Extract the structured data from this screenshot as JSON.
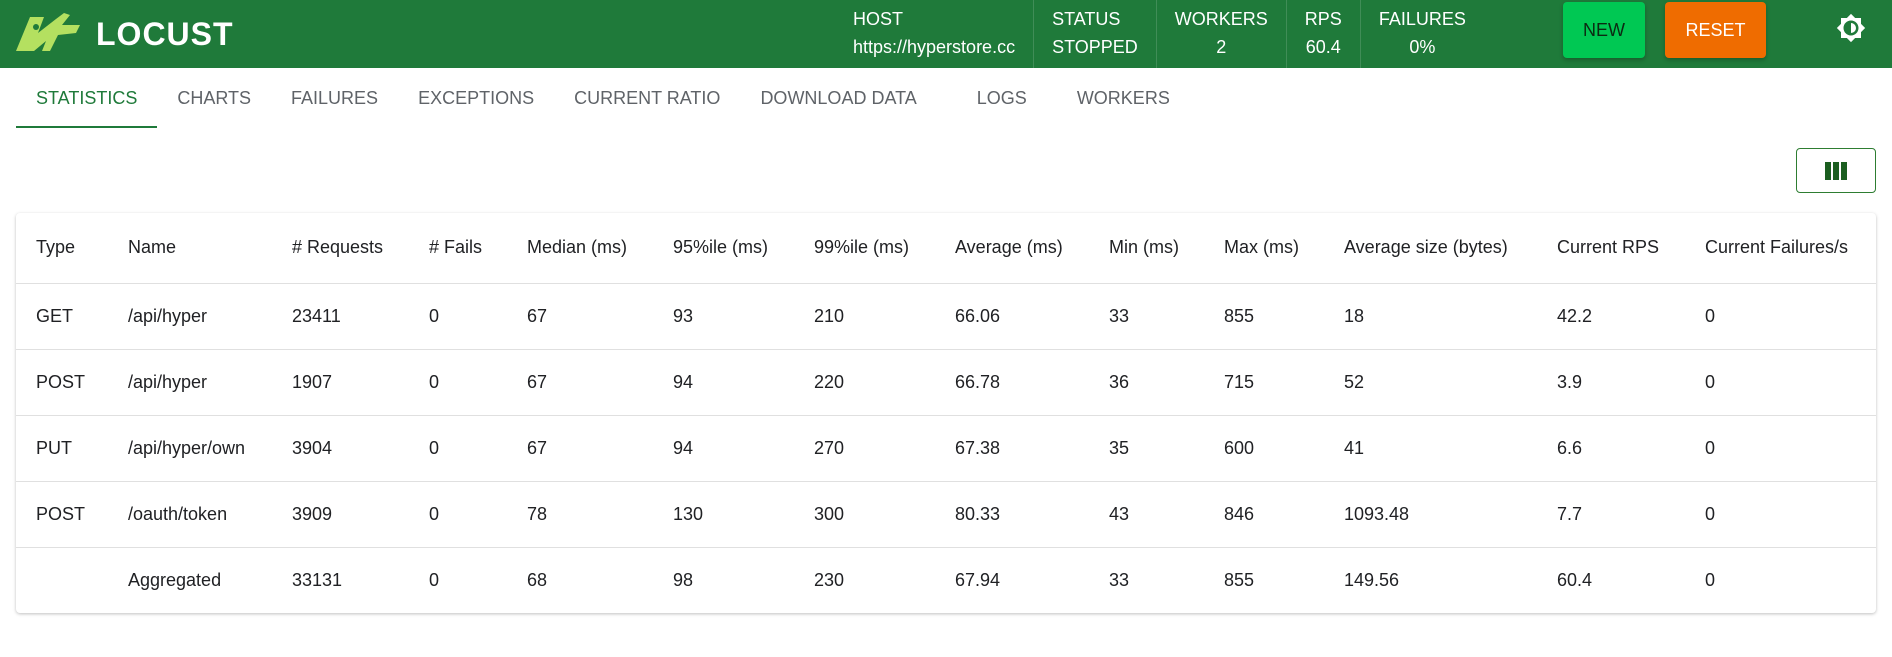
{
  "header": {
    "brand": "LOCUST",
    "stats": [
      {
        "label": "HOST",
        "value": "https://hyperstore.cc"
      },
      {
        "label": "STATUS",
        "value": "STOPPED"
      },
      {
        "label": "WORKERS",
        "value": "2"
      },
      {
        "label": "RPS",
        "value": "60.4"
      },
      {
        "label": "FAILURES",
        "value": "0%"
      }
    ],
    "new_label": "NEW",
    "reset_label": "RESET",
    "theme_icon": "brightness-icon"
  },
  "tabs": [
    {
      "label": "STATISTICS",
      "active": true
    },
    {
      "label": "CHARTS"
    },
    {
      "label": "FAILURES"
    },
    {
      "label": "EXCEPTIONS"
    },
    {
      "label": "CURRENT RATIO"
    },
    {
      "label": "DOWNLOAD DATA"
    },
    {
      "label": "LOGS"
    },
    {
      "label": "WORKERS"
    }
  ],
  "table": {
    "columns": [
      "Type",
      "Name",
      "# Requests",
      "# Fails",
      "Median (ms)",
      "95%ile (ms)",
      "99%ile (ms)",
      "Average (ms)",
      "Min (ms)",
      "Max (ms)",
      "Average size (bytes)",
      "Current RPS",
      "Current Failures/s"
    ],
    "rows": [
      [
        "GET",
        "/api/hyper",
        "23411",
        "0",
        "67",
        "93",
        "210",
        "66.06",
        "33",
        "855",
        "18",
        "42.2",
        "0"
      ],
      [
        "POST",
        "/api/hyper",
        "1907",
        "0",
        "67",
        "94",
        "220",
        "66.78",
        "36",
        "715",
        "52",
        "3.9",
        "0"
      ],
      [
        "PUT",
        "/api/hyper/own",
        "3904",
        "0",
        "67",
        "94",
        "270",
        "67.38",
        "35",
        "600",
        "41",
        "6.6",
        "0"
      ],
      [
        "POST",
        "/oauth/token",
        "3909",
        "0",
        "78",
        "130",
        "300",
        "80.33",
        "43",
        "846",
        "1093.48",
        "7.7",
        "0"
      ],
      [
        "",
        "Aggregated",
        "33131",
        "0",
        "68",
        "98",
        "230",
        "67.94",
        "33",
        "855",
        "149.56",
        "60.4",
        "0"
      ]
    ]
  },
  "colors": {
    "header_bg": "#1f7a3a",
    "new_button": "#00c853",
    "reset_button": "#ef6c00",
    "active_tab": "#1f7a3a"
  }
}
